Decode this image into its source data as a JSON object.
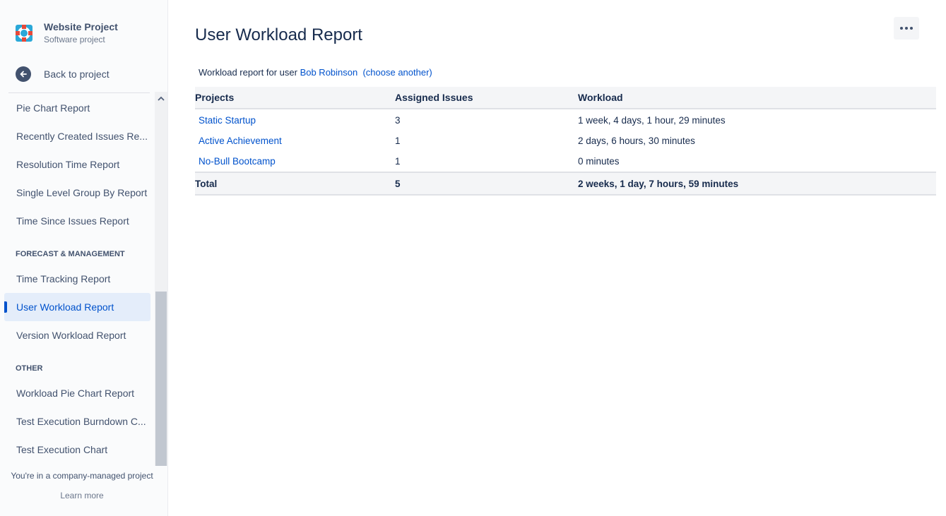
{
  "project": {
    "name": "Website Project",
    "type": "Software project",
    "avatar_icon": "lifebuoy-icon",
    "avatar_color": "#2aa8d8"
  },
  "sidebar": {
    "back_label": "Back to project",
    "items_top": [
      {
        "label": "Pie Chart Report"
      },
      {
        "label": "Recently Created Issues Re..."
      },
      {
        "label": "Resolution Time Report"
      },
      {
        "label": "Single Level Group By Report"
      },
      {
        "label": "Time Since Issues Report"
      }
    ],
    "section_forecast": "FORECAST & MANAGEMENT",
    "items_forecast": [
      {
        "label": "Time Tracking Report"
      },
      {
        "label": "User Workload Report",
        "active": true
      },
      {
        "label": "Version Workload Report"
      }
    ],
    "section_other": "OTHER",
    "items_other": [
      {
        "label": "Workload Pie Chart Report"
      },
      {
        "label": "Test Execution Burndown C..."
      },
      {
        "label": "Test Execution Chart"
      }
    ],
    "footer_text": "You're in a company-managed project",
    "footer_link": "Learn more"
  },
  "main": {
    "title": "User Workload Report",
    "more_icon": "more-horizontal-icon",
    "intro_prefix": "Workload report for user",
    "user_name": "Bob Robinson",
    "choose_another": "(choose another)",
    "table": {
      "headers": [
        "Projects",
        "Assigned Issues",
        "Workload"
      ],
      "rows": [
        {
          "project": "Static Startup",
          "issues": "3",
          "workload": "1 week, 4 days, 1 hour, 29 minutes"
        },
        {
          "project": "Active Achievement",
          "issues": "1",
          "workload": "2 days, 6 hours, 30 minutes"
        },
        {
          "project": "No-Bull Bootcamp",
          "issues": "1",
          "workload": "0 minutes"
        }
      ],
      "total": {
        "label": "Total",
        "issues": "5",
        "workload": "2 weeks, 1 day, 7 hours, 59 minutes"
      }
    }
  },
  "colors": {
    "link": "#0052cc",
    "active_bg": "#e4edfa",
    "text": "#172b4d"
  }
}
